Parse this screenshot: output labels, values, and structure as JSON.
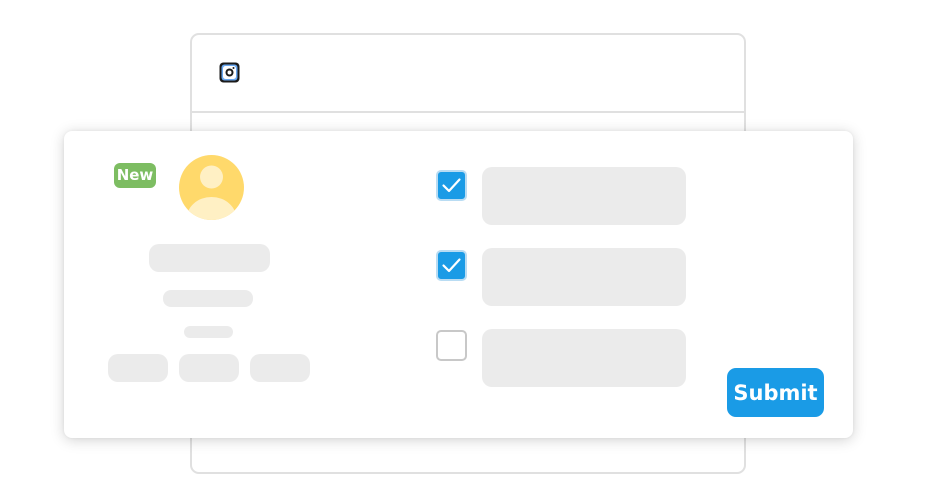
{
  "colors": {
    "accent": "#1a9be6",
    "badge_green": "#7dbd62",
    "avatar_bg": "#ffd96b",
    "avatar_figure": "#fff0c4",
    "skeleton": "#ebebeb",
    "border": "#e0e0e0"
  },
  "window": {
    "icon": "camera-app-icon"
  },
  "profile": {
    "badge_label": "New",
    "avatar_icon": "user-avatar-icon"
  },
  "checklist": {
    "items": [
      {
        "checked": true
      },
      {
        "checked": true
      },
      {
        "checked": false
      }
    ]
  },
  "form": {
    "submit_label": "Submit"
  }
}
